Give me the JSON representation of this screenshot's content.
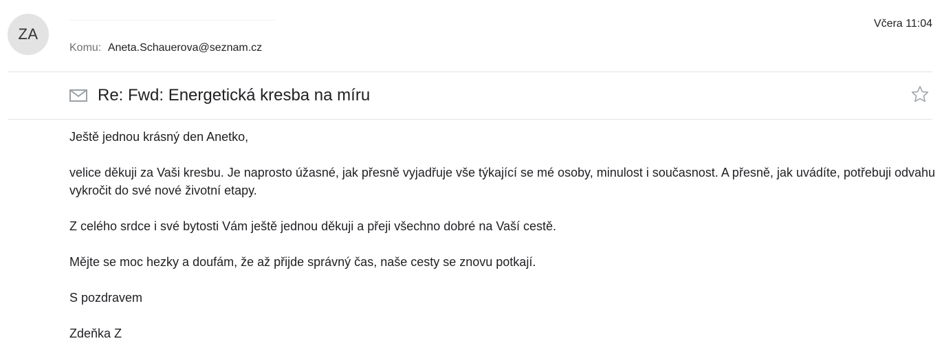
{
  "sender": {
    "avatar_initials": "ZA"
  },
  "header": {
    "time": "Včera 11:04",
    "recipient_label": "Komu:",
    "recipient_email": "Aneta.Schauerova@seznam.cz"
  },
  "subject": {
    "text": "Re: Fwd: Energetická kresba na míru",
    "icon": "mail-icon",
    "star_icon": "star-outline-icon"
  },
  "body": {
    "paragraphs": [
      "Ještě jednou krásný den Anetko,",
      "velice děkuji za Vaši kresbu. Je naprosto úžasné, jak přesně vyjadřuje vše týkající se mé osoby, minulost i současnost. A přesně, jak uvádíte, potřebuji odvahu vykročit do své nové životní etapy.",
      "Z celého srdce i své bytosti Vám ještě jednou děkuji a přeji všechno dobré na Vaší cestě.",
      "Mějte se moc hezky a doufám, že až přijde správný čas, naše cesty se znovu potkají.",
      "S pozdravem",
      "Zdeňka Z"
    ]
  },
  "colors": {
    "avatar_bg": "#e3e3e3",
    "text": "#202124",
    "muted": "#6f6f6f",
    "divider": "#e3e3e3",
    "icon": "#9aa0a6"
  }
}
